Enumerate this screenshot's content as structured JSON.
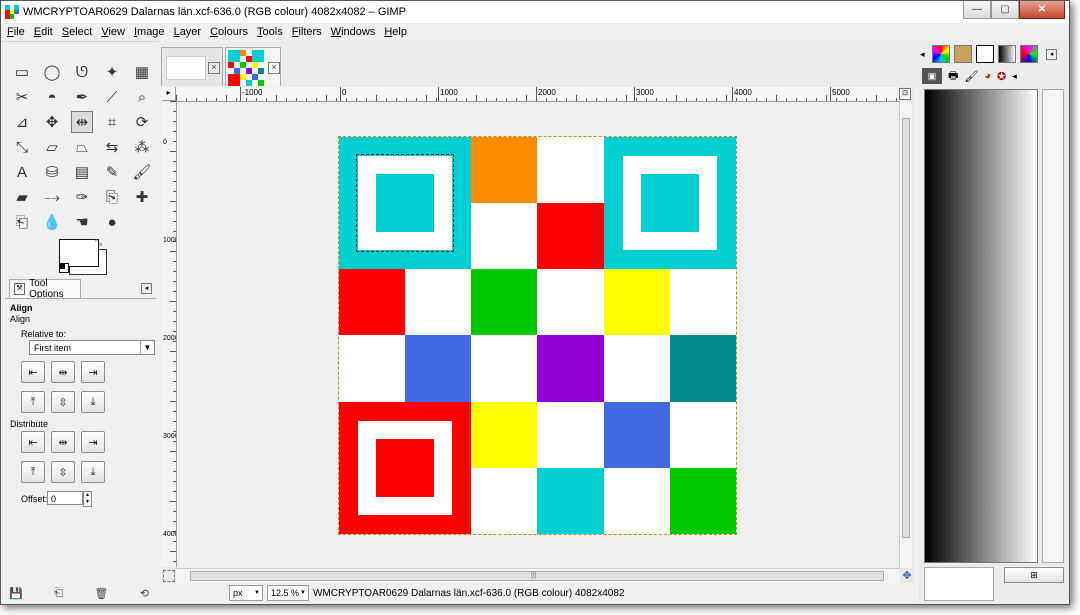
{
  "window": {
    "title": "WMCRYPTOAR0629 Dalarnas län.xcf-636.0 (RGB colour) 4082x4082 – GIMP",
    "controls": {
      "minimize": "—",
      "maximize": "▢",
      "close": "✕"
    }
  },
  "menubar": {
    "items": [
      "File",
      "Edit",
      "Select",
      "View",
      "Image",
      "Layer",
      "Colours",
      "Tools",
      "Filters",
      "Windows",
      "Help"
    ]
  },
  "toolbox": {
    "tools": [
      {
        "name": "rect-select-icon",
        "glyph": "▭"
      },
      {
        "name": "ellipse-select-icon",
        "glyph": "◯"
      },
      {
        "name": "free-select-icon",
        "glyph": "ᘎ"
      },
      {
        "name": "fuzzy-select-icon",
        "glyph": "✦"
      },
      {
        "name": "color-select-icon",
        "glyph": "▦"
      },
      {
        "name": "scissors-select-icon",
        "glyph": "✂"
      },
      {
        "name": "foreground-select-icon",
        "glyph": "◓"
      },
      {
        "name": "paths-icon",
        "glyph": "✒"
      },
      {
        "name": "color-picker-icon",
        "glyph": "⟋"
      },
      {
        "name": "zoom-icon",
        "glyph": "⌕"
      },
      {
        "name": "measure-icon",
        "glyph": "⊿"
      },
      {
        "name": "move-icon",
        "glyph": "✥"
      },
      {
        "name": "align-icon",
        "glyph": "⇹"
      },
      {
        "name": "crop-icon",
        "glyph": "⌗"
      },
      {
        "name": "rotate-icon",
        "glyph": "⟳"
      },
      {
        "name": "scale-icon",
        "glyph": "⤡"
      },
      {
        "name": "shear-icon",
        "glyph": "▱"
      },
      {
        "name": "perspective-icon",
        "glyph": "⏢"
      },
      {
        "name": "flip-icon",
        "glyph": "⇆"
      },
      {
        "name": "cage-icon",
        "glyph": "⁂"
      },
      {
        "name": "text-icon",
        "glyph": "A"
      },
      {
        "name": "bucket-fill-icon",
        "glyph": "⛁"
      },
      {
        "name": "blend-icon",
        "glyph": "▤"
      },
      {
        "name": "pencil-icon",
        "glyph": "✎"
      },
      {
        "name": "paintbrush-icon",
        "glyph": "🖌"
      },
      {
        "name": "eraser-icon",
        "glyph": "▰"
      },
      {
        "name": "airbrush-icon",
        "glyph": "⤍"
      },
      {
        "name": "ink-icon",
        "glyph": "✑"
      },
      {
        "name": "clone-icon",
        "glyph": "⎘"
      },
      {
        "name": "heal-icon",
        "glyph": "✚"
      },
      {
        "name": "perspective-clone-icon",
        "glyph": "⎗"
      },
      {
        "name": "blur-icon",
        "glyph": "💧"
      },
      {
        "name": "smudge-icon",
        "glyph": "☚"
      },
      {
        "name": "dodge-burn-icon",
        "glyph": "●"
      }
    ]
  },
  "tool_options": {
    "tab_label": "Tool Options",
    "heading": "Align",
    "subheading": "Align",
    "relative_label": "Relative to:",
    "relative_value": "First item",
    "distribute_label": "Distribute",
    "offset_label": "Offset:",
    "offset_value": "0"
  },
  "ruler": {
    "h_labels": [
      "-1000",
      "0",
      "1000",
      "2000",
      "3000",
      "4000",
      "5000"
    ],
    "v_labels": [
      "0",
      "1000",
      "2000",
      "3000",
      "4000"
    ]
  },
  "image_grid": {
    "colors": {
      "cyan": "#00ced1",
      "orange": "#ff8c00",
      "red": "#ff0000",
      "green": "#00c800",
      "yellow": "#ffff00",
      "blue": "#4169e1",
      "purple": "#9400d3",
      "teal": "#008b8b",
      "white": "#ffffff"
    },
    "cells": [
      [
        "cyan",
        "cyan",
        "orange",
        "white",
        "cyan",
        "cyan"
      ],
      [
        "cyan",
        "cyan",
        "white",
        "red",
        "cyan",
        "cyan"
      ],
      [
        "red",
        "white",
        "green",
        "white",
        "yellow",
        "white"
      ],
      [
        "white",
        "blue",
        "white",
        "purple",
        "white",
        "teal"
      ],
      [
        "red",
        "red",
        "yellow",
        "white",
        "blue",
        "white"
      ],
      [
        "red",
        "red",
        "white",
        "cyan",
        "white",
        "green"
      ]
    ]
  },
  "statusbar": {
    "unit": "px",
    "zoom": "12.5 %",
    "message": "WMCRYPTOAR0629 Dalarnas län.xcf-636.0 (RGB colour) 4082x4082"
  }
}
